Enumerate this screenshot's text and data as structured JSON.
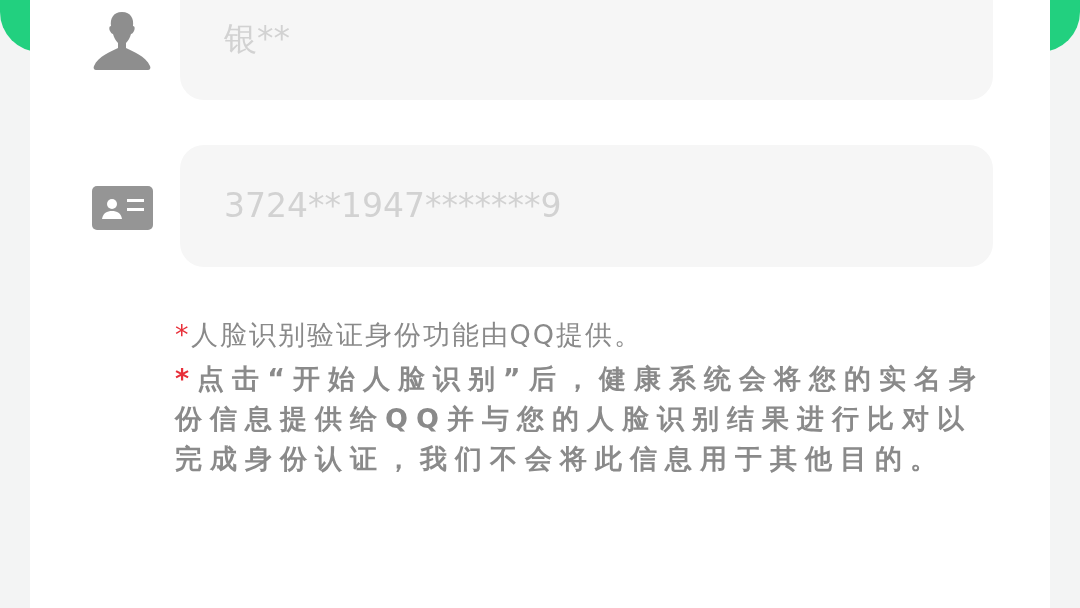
{
  "fields": [
    {
      "kind": "person",
      "value": "银**"
    },
    {
      "kind": "id-card",
      "value": "3724**1947*******9"
    }
  ],
  "notes": [
    {
      "marker": "*",
      "text": "人脸识别验证身份功能由QQ提供。",
      "bold": false
    },
    {
      "marker": "*",
      "text": "点击“开始人脸识别”后，健康系统会将您的实名身份信息提供给QQ并与您的人脸识别结果进行比对以完成身份认证，我们不会将此信息用于其他目的。",
      "bold": true
    }
  ]
}
